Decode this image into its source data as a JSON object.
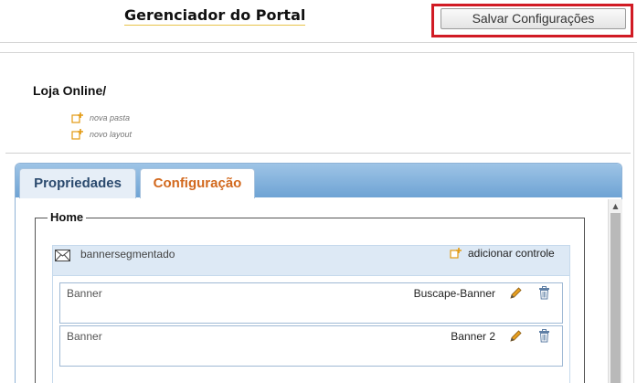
{
  "header": {
    "title": "Gerenciador do Portal",
    "save_button": "Salvar Configurações"
  },
  "breadcrumb": "Loja Online/",
  "actions": {
    "new_folder": "nova pasta",
    "new_layout": "novo layout"
  },
  "tabs": [
    {
      "label": "Propriedades",
      "active": false
    },
    {
      "label": "Configuração",
      "active": true
    }
  ],
  "section": {
    "legend": "Home",
    "control": {
      "name": "bannersegmentado",
      "add_label": "adicionar controle"
    },
    "items": [
      {
        "type": "Banner",
        "value": "Buscape-Banner"
      },
      {
        "type": "Banner",
        "value": "Banner 2"
      }
    ]
  },
  "colors": {
    "highlight": "#d11b24",
    "tab_active_text": "#d2691e",
    "tab_strip": "#6ea3d4"
  }
}
